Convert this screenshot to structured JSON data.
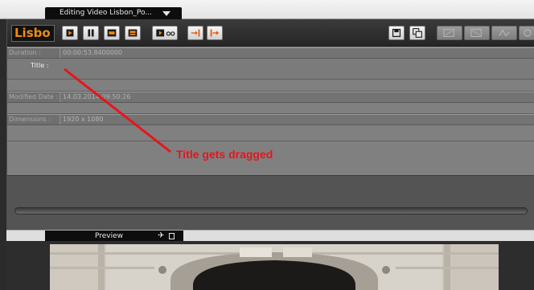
{
  "window": {
    "title": "Editing Video Lisbon_Po..."
  },
  "toolbar": {
    "name": "Lisbo",
    "buttons": [
      {
        "name": "play-icon"
      },
      {
        "name": "pause-icon"
      },
      {
        "name": "next-frame-icon"
      },
      {
        "name": "export-icon"
      },
      {
        "name": "video-link-icon"
      },
      {
        "name": "mark-in-icon"
      },
      {
        "name": "mark-out-icon"
      },
      {
        "name": "save-icon"
      },
      {
        "name": "save-copy-icon"
      },
      {
        "name": "crop-icon"
      },
      {
        "name": "crop-alt-icon"
      },
      {
        "name": "curve-icon"
      },
      {
        "name": "refresh-icon"
      }
    ]
  },
  "properties": {
    "duration": {
      "label": "Duration :",
      "value": "00:00:53.8400000"
    },
    "title": {
      "label": "Title :"
    },
    "modified_date": {
      "label": "Modified Date :",
      "value": "14.03.2014 09:50:26"
    },
    "dimensions": {
      "label": "Dimensions :",
      "value": "1920 x 1080"
    }
  },
  "annotation": {
    "text": "Title gets dragged",
    "color": "#e8141a"
  },
  "preview": {
    "label": "Preview"
  }
}
